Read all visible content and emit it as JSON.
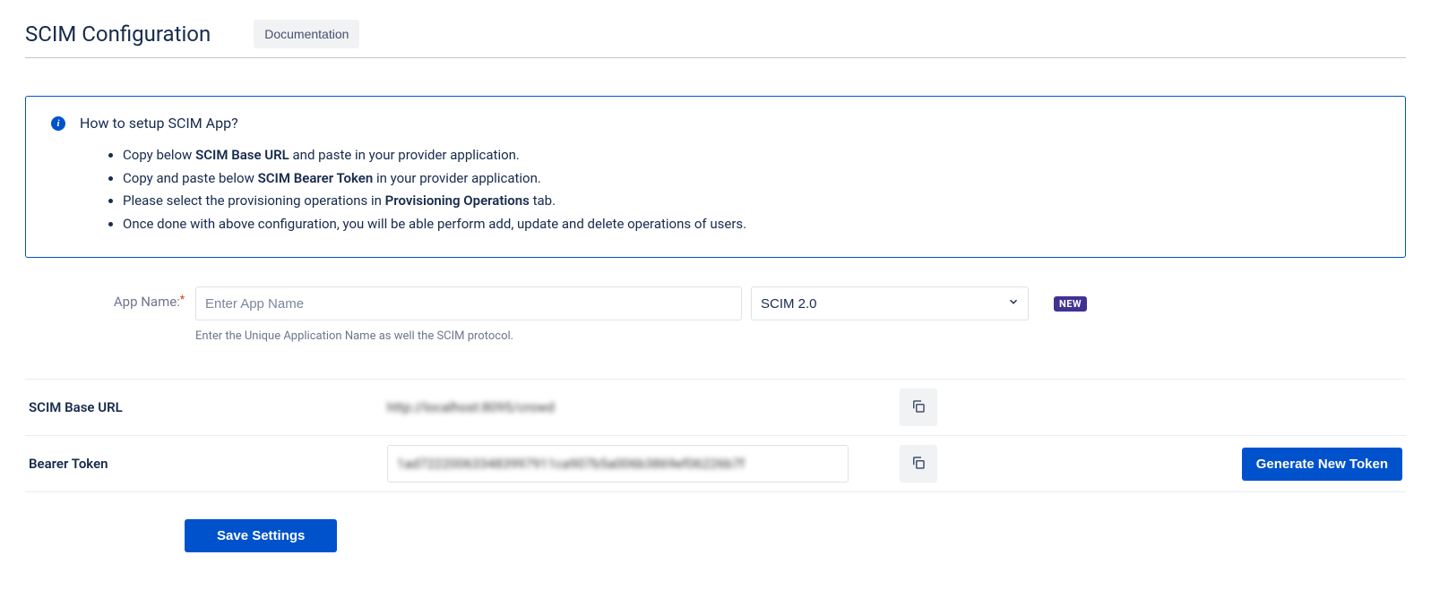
{
  "header": {
    "title": "SCIM Configuration",
    "documentation_label": "Documentation"
  },
  "info": {
    "heading": "How to setup SCIM App?",
    "items": [
      {
        "pre": "Copy below ",
        "bold": "SCIM Base URL",
        "post": " and paste in your provider application."
      },
      {
        "pre": "Copy and paste below ",
        "bold": "SCIM Bearer Token",
        "post": " in your provider application."
      },
      {
        "pre": "Please select the provisioning operations in ",
        "bold": "Provisioning Operations",
        "post": " tab."
      },
      {
        "pre": "Once done with above configuration, you will be able perform add, update and delete operations of users.",
        "bold": "",
        "post": ""
      }
    ]
  },
  "form": {
    "app_name_label": "App Name:",
    "app_name_placeholder": "Enter App Name",
    "app_name_value": "",
    "protocol_selected": "SCIM 2.0",
    "badge_new": "NEW",
    "help_text": "Enter the Unique Application Name as well the SCIM protocol."
  },
  "rows": {
    "base_url_label": "SCIM Base URL",
    "base_url_value": "http://localhost:8095/crowd",
    "bearer_label": "Bearer Token",
    "bearer_value": "1ad722200633483997911ca907b5a006b3869ef06226b7f",
    "generate_label": "Generate New Token"
  },
  "actions": {
    "save_label": "Save Settings"
  }
}
